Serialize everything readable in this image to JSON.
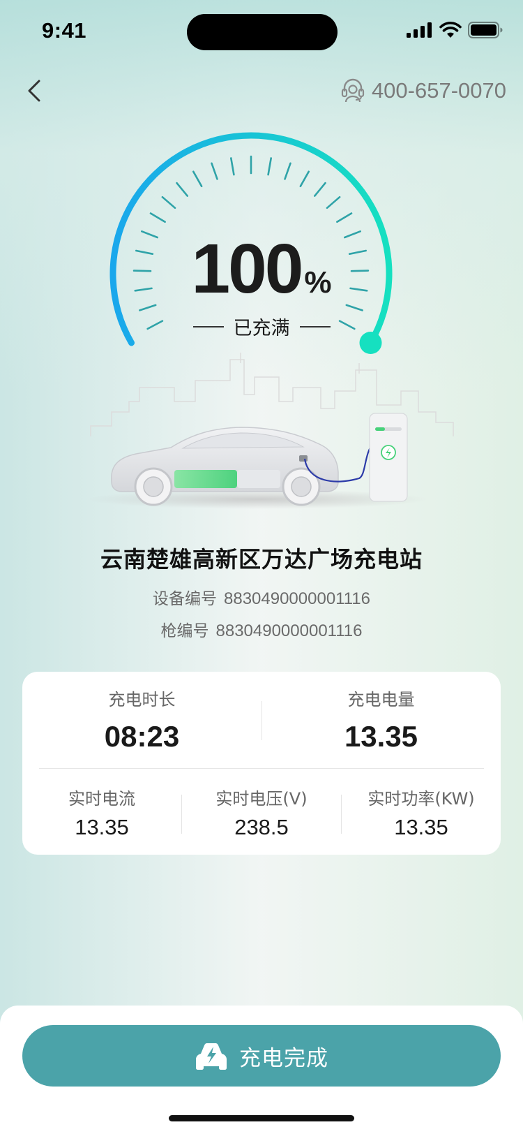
{
  "status_bar": {
    "time": "9:41"
  },
  "header": {
    "back_icon": "chevron-left-icon",
    "phone_icon": "headset-icon",
    "phone_number": "400-657-0070"
  },
  "gauge": {
    "percent_value": "100",
    "percent_unit": "%",
    "status_label": "已充满",
    "level_fraction": 1.0,
    "colors": {
      "start": "#1aa7ec",
      "end": "#16e0c0",
      "ticks": "#2fa3a8"
    }
  },
  "station": {
    "name": "云南楚雄高新区万达广场充电站",
    "device_label": "设备编号",
    "device_number": "8830490000001116",
    "gun_label": "枪编号",
    "gun_number": "8830490000001116"
  },
  "stats": {
    "duration_label": "充电时长",
    "duration_value": "08:23",
    "energy_label": "充电电量",
    "energy_value": "13.35",
    "current_label": "实时电流",
    "current_value": "13.35",
    "voltage_label": "实时电压(V)",
    "voltage_value": "238.5",
    "power_label": "实时功率(KW)",
    "power_value": "13.35"
  },
  "action": {
    "finish_label": "充电完成",
    "finish_icon": "car-bolt-icon",
    "button_color": "#4ba3a9"
  }
}
